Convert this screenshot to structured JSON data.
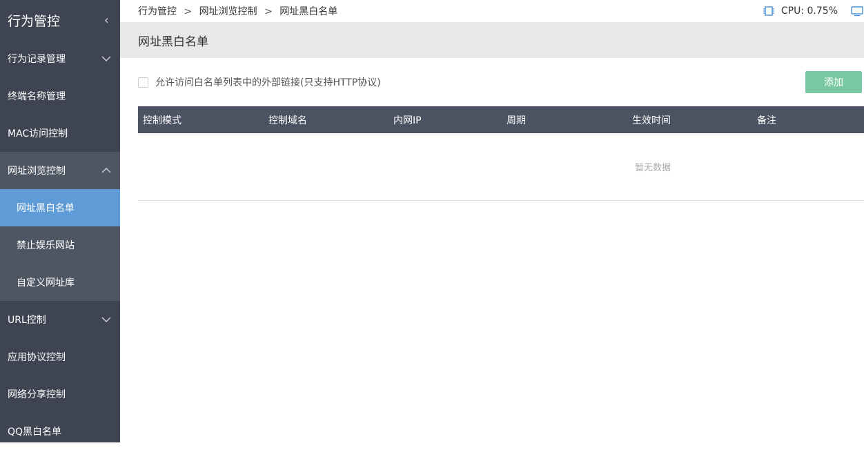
{
  "sidebar": {
    "title": "行为管控",
    "collapse_glyph": "‹",
    "items": [
      {
        "label": "行为记录管理"
      },
      {
        "label": "终端名称管理"
      },
      {
        "label": "MAC访问控制"
      },
      {
        "label": "网址浏览控制"
      },
      {
        "label": "URL控制"
      },
      {
        "label": "应用协议控制"
      },
      {
        "label": "网络分享控制"
      },
      {
        "label": "QQ黑白名单"
      }
    ],
    "subitems": [
      {
        "label": "网址黑白名单"
      },
      {
        "label": "禁止娱乐网站"
      },
      {
        "label": "自定义网址库"
      }
    ]
  },
  "breadcrumb": {
    "items": [
      "行为管控",
      "网址浏览控制",
      "网址黑白名单"
    ],
    "separator": ">"
  },
  "status": {
    "cpu_label": "CPU: 0.75%",
    "icons": [
      "cpu-chip-icon",
      "monitor-icon"
    ]
  },
  "page": {
    "title": "网址黑白名单",
    "checkbox_label": "允许访问白名单列表中的外部链接(只支持HTTP协议)",
    "checkbox_checked": false,
    "add_button": "添加",
    "add_button_color": "#7ac8a1"
  },
  "table": {
    "columns": [
      "控制模式",
      "控制域名",
      "内网IP",
      "周期",
      "生效时间",
      "备注"
    ],
    "empty_text": "暂无数据"
  },
  "colors": {
    "sidebar_bg": "#3e4451",
    "sidebar_open_bg": "#4f5663",
    "sidebar_active_bg": "#5f9bd6",
    "table_header_bg": "#4b5261"
  }
}
